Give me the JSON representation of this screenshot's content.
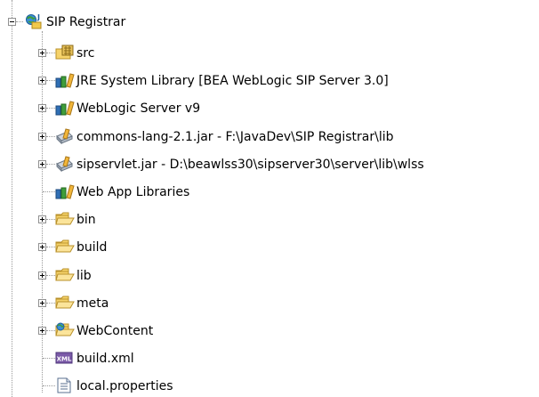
{
  "project": {
    "name": "SIP Registrar",
    "icon": "web-project-icon",
    "expanded": true
  },
  "children": [
    {
      "label": "src",
      "icon": "source-folder-icon",
      "expandable": true
    },
    {
      "label": "JRE System Library [BEA WebLogic SIP Server 3.0]",
      "icon": "library-icon",
      "expandable": true
    },
    {
      "label": "WebLogic Server v9",
      "icon": "library-icon",
      "expandable": true
    },
    {
      "label": "commons-lang-2.1.jar - F:\\JavaDev\\SIP Registrar\\lib",
      "icon": "jar-icon",
      "expandable": true
    },
    {
      "label": "sipservlet.jar - D:\\beawlss30\\sipserver30\\server\\lib\\wlss",
      "icon": "jar-icon",
      "expandable": true
    },
    {
      "label": "Web App Libraries",
      "icon": "library-icon",
      "expandable": false
    },
    {
      "label": "bin",
      "icon": "folder-icon",
      "expandable": true
    },
    {
      "label": "build",
      "icon": "folder-icon",
      "expandable": true
    },
    {
      "label": "lib",
      "icon": "folder-icon",
      "expandable": true
    },
    {
      "label": "meta",
      "icon": "folder-icon",
      "expandable": true
    },
    {
      "label": "WebContent",
      "icon": "web-folder-icon",
      "expandable": true
    },
    {
      "label": "build.xml",
      "icon": "xml-file-icon",
      "expandable": false
    },
    {
      "label": "local.properties",
      "icon": "text-file-icon",
      "expandable": false
    }
  ]
}
